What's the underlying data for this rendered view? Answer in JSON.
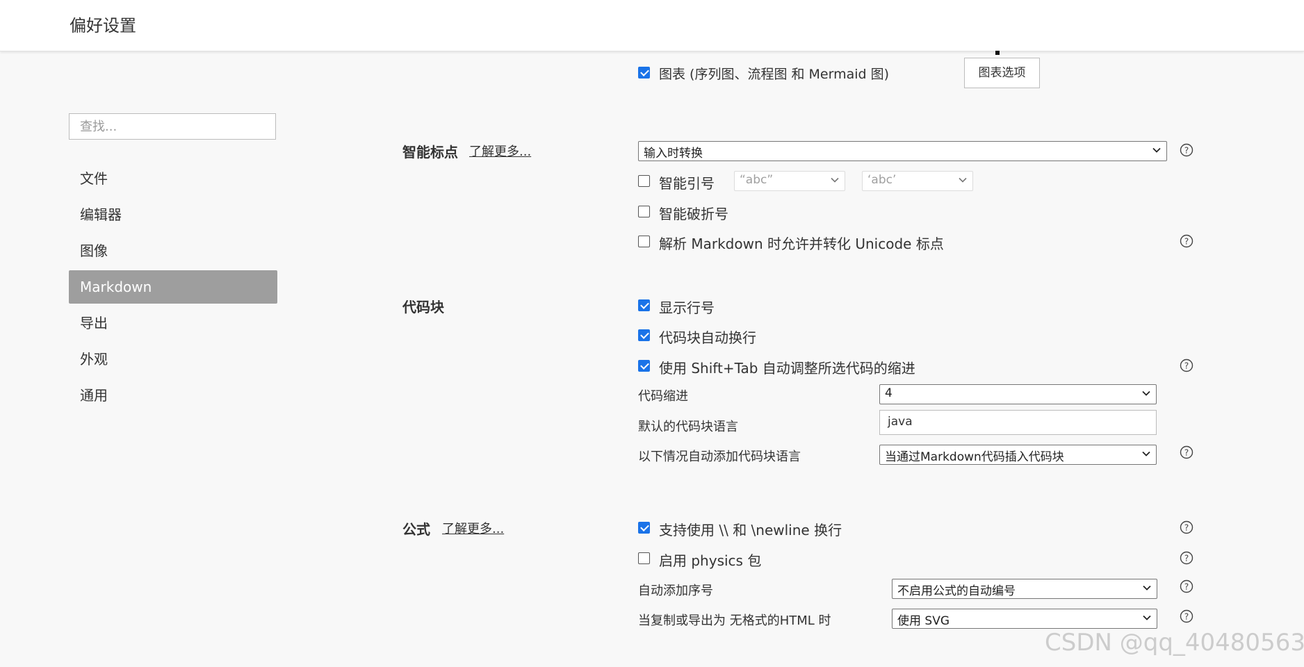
{
  "window": {
    "title": "偏好设置"
  },
  "sidebar": {
    "search_placeholder": "查找...",
    "items": [
      {
        "label": "文件",
        "active": false
      },
      {
        "label": "编辑器",
        "active": false
      },
      {
        "label": "图像",
        "active": false
      },
      {
        "label": "Markdown",
        "active": true
      },
      {
        "label": "导出",
        "active": false
      },
      {
        "label": "外观",
        "active": false
      },
      {
        "label": "通用",
        "active": false
      }
    ]
  },
  "diagrams": {
    "checkbox_label": "图表 (序列图、流程图 和 Mermaid 图)",
    "checked": true,
    "options_button": "图表选项"
  },
  "smart_punct": {
    "title": "智能标点",
    "learn_more": "了解更多...",
    "mode_select": "输入时转换",
    "smart_quotes": {
      "label": "智能引号",
      "checked": false,
      "double_select": "“abc”",
      "single_select": "‘abc’"
    },
    "smart_dashes": {
      "label": "智能破折号",
      "checked": false
    },
    "unicode_punct": {
      "label": "解析 Markdown 时允许并转化 Unicode 标点",
      "checked": false
    }
  },
  "code_block": {
    "title": "代码块",
    "line_numbers": {
      "label": "显示行号",
      "checked": true
    },
    "word_wrap": {
      "label": "代码块自动换行",
      "checked": true
    },
    "shift_tab": {
      "label": "使用 Shift+Tab 自动调整所选代码的缩进",
      "checked": true
    },
    "indent": {
      "label": "代码缩进",
      "value": "4"
    },
    "default_lang": {
      "label": "默认的代码块语言",
      "value": "java"
    },
    "auto_lang": {
      "label": "以下情况自动添加代码块语言",
      "value": "当通过Markdown代码插入代码块"
    }
  },
  "math": {
    "title": "公式",
    "learn_more": "了解更多...",
    "newline": {
      "label": "支持使用 \\\\ 和 \\newline 换行",
      "checked": true
    },
    "physics": {
      "label": "启用 physics 包",
      "checked": false
    },
    "auto_number": {
      "label": "自动添加序号",
      "value": "不启用公式的自动编号"
    },
    "export_html": {
      "label": "当复制或导出为 无格式的HTML 时",
      "value": "使用 SVG"
    }
  },
  "watermark": "CSDN @qq_40480563",
  "colors": {
    "accent": "#1a73e8",
    "active_nav": "#9e9e9e",
    "background": "#f8f8f8"
  }
}
